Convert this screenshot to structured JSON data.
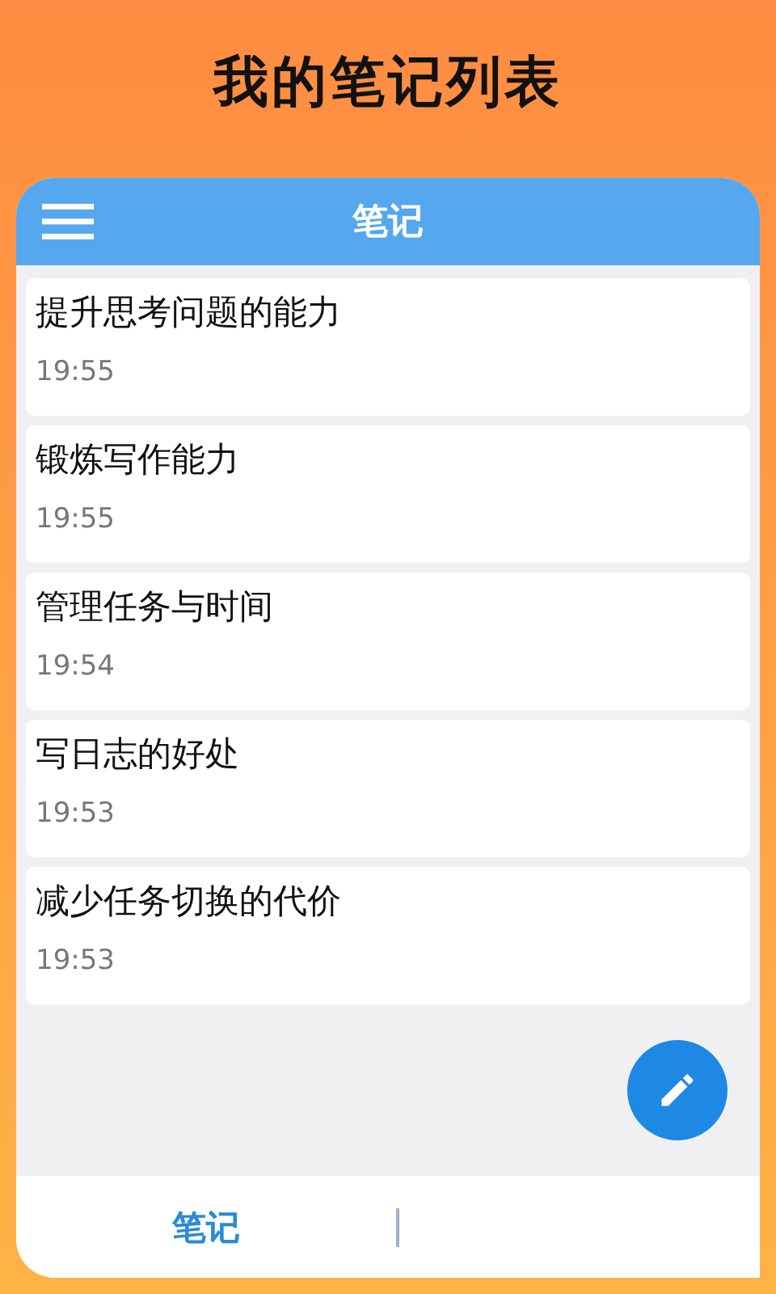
{
  "headline": "我的笔记列表",
  "app_bar": {
    "title": "笔记"
  },
  "notes": [
    {
      "title": "提升思考问题的能力",
      "time": "19:55"
    },
    {
      "title": "锻炼写作能力",
      "time": "19:55"
    },
    {
      "title": "管理任务与时间",
      "time": "19:54"
    },
    {
      "title": "写日志的好处",
      "time": "19:53"
    },
    {
      "title": "减少任务切换的代价",
      "time": "19:53"
    }
  ],
  "bottom_tabs": [
    {
      "label": "笔记",
      "selected": true
    }
  ]
}
